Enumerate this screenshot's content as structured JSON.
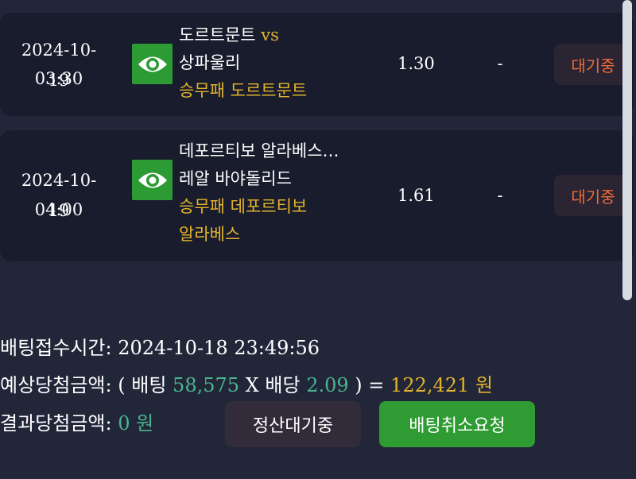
{
  "bets": [
    {
      "date": "2024-10-19",
      "time": "03:30",
      "team1": "도르트문트",
      "vs": "vs",
      "team2": "상파울리",
      "pick1": "승무패 도르트문트",
      "pick2": "",
      "odds": "1.30",
      "result": "-",
      "status": "대기중",
      "icon": "eye-icon"
    },
    {
      "date": "2024-10-19",
      "time": "04:00",
      "team1": "데포르티보 알라베스…",
      "vs": "",
      "team2": "레알 바야돌리드",
      "pick1": "승무패 데포르티보",
      "pick2": "알라베스",
      "odds": "1.61",
      "result": "-",
      "status": "대기중",
      "icon": "eye-icon"
    }
  ],
  "summary": {
    "receipt_label": "배팅접수시간",
    "receipt_colon": ":",
    "receipt_time": "2024-10-18 23:49:56",
    "expected_label": "예상당첨금액",
    "expected_colon": ":",
    "open_paren": "(",
    "bet_word": "배팅",
    "bet_amount": "58,575",
    "times": "X",
    "odds_word": "배당",
    "total_odds": "2.09",
    "close_paren_eq": ") =",
    "expected_amount": "122,421",
    "won": "원",
    "result_label": "결과당첨금액",
    "result_colon": ":",
    "result_amount": "0",
    "result_won": "원"
  },
  "buttons": {
    "settle": "정산대기중",
    "cancel": "배팅취소요청"
  },
  "colors": {
    "background": "#222639",
    "card": "#181c2d",
    "gold": "#e4b42b",
    "green_text": "#4ab48f",
    "status_orange": "#ef6b35",
    "button_green": "#2f9b33"
  }
}
